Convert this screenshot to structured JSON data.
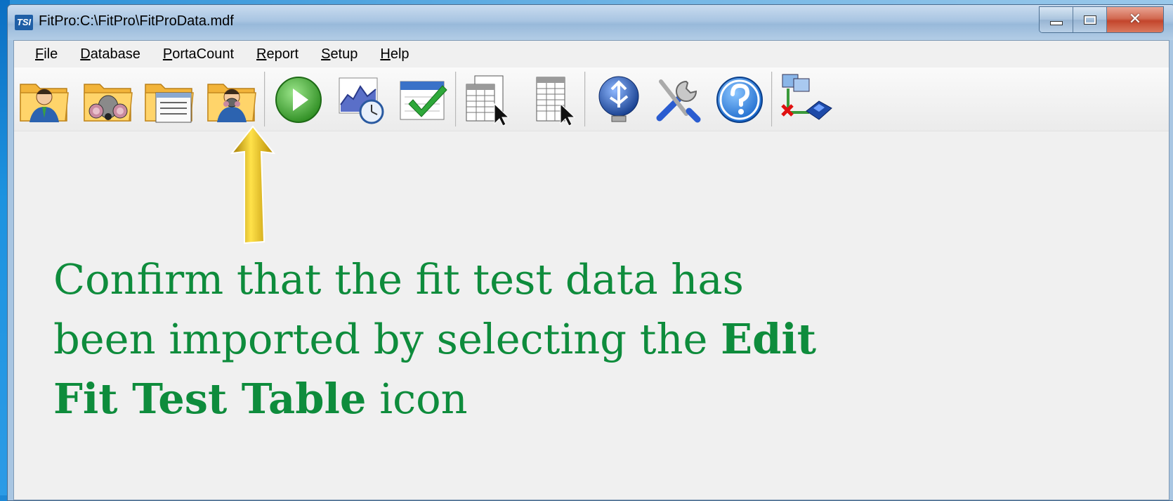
{
  "window": {
    "title": "FitPro:C:\\FitPro\\FitProData.mdf",
    "logo_text": "TSI",
    "close_glyph": "✕"
  },
  "menu": [
    {
      "accel": "F",
      "rest": "ile"
    },
    {
      "accel": "D",
      "rest": "atabase"
    },
    {
      "accel": "P",
      "rest": "ortaCount"
    },
    {
      "accel": "R",
      "rest": "eport"
    },
    {
      "accel": "S",
      "rest": "etup"
    },
    {
      "accel": "H",
      "rest": "elp"
    }
  ],
  "toolbar": {
    "icons": [
      "people-folder-icon",
      "respirator-folder-icon",
      "fit-test-table-folder-icon",
      "edit-fit-test-folder-icon",
      "start-fit-test-icon",
      "chart-clock-icon",
      "calendar-check-icon",
      "select-records-icon",
      "select-table-icon",
      "usb-globe-icon",
      "tools-icon",
      "help-icon",
      "network-disconnected-icon"
    ]
  },
  "instruction": {
    "line_text_1": "Confirm that the fit test data has been imported by selecting the ",
    "bold_text": "Edit Fit Test Table",
    "line_text_2": " icon"
  },
  "colors": {
    "instruction_text": "#0e8c3c",
    "arrow": "#e8b800"
  }
}
